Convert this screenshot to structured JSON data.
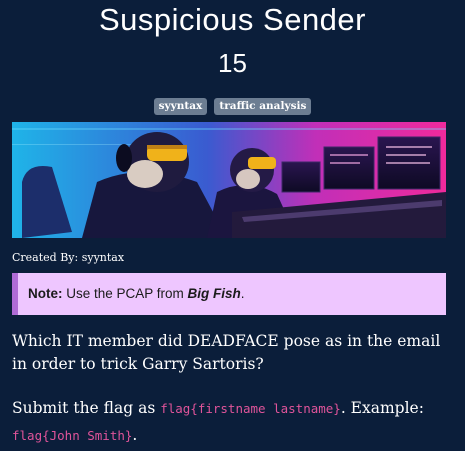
{
  "challenge": {
    "title": "Suspicious Sender",
    "points": "15"
  },
  "tags": [
    "syyntax",
    "traffic analysis"
  ],
  "created_by": "Created By: syyntax",
  "note": {
    "label": "Note:",
    "text_before": " Use the PCAP from ",
    "link": "Big Fish",
    "text_after": "."
  },
  "question": "Which IT member did DEADFACE pose as in the email in order to trick Garry Sartoris?",
  "submit": {
    "prefix": "Submit the flag as ",
    "format_code": "flag{firstname lastname}",
    "middle": ". Example: ",
    "example_code": "flag{John Smith}",
    "suffix": "."
  },
  "colors": {
    "background": "#0b1e3a",
    "tag_bg": "#6c7d92",
    "note_bg": "#eec6ff",
    "note_border": "#b06cd6",
    "code": "#e0549a"
  }
}
